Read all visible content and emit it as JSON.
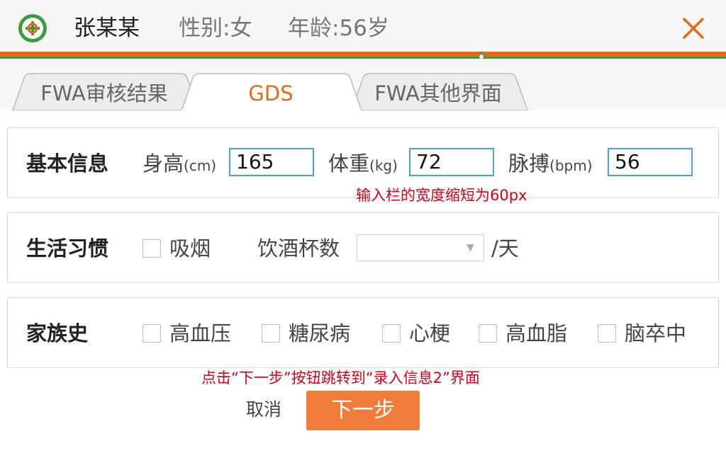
{
  "header": {
    "name": "张某某",
    "gender": "性别:女",
    "age": "年龄:56岁",
    "logo_icon": "app-logo-icon",
    "close_icon": "close-icon",
    "accent_color": "#e8661a"
  },
  "tabs": [
    {
      "label": "FWA审核结果",
      "active": false
    },
    {
      "label": "GDS",
      "active": true
    },
    {
      "label": "FWA其他界面",
      "active": false
    }
  ],
  "basic_info": {
    "title": "基本信息",
    "height_label": "身高",
    "height_unit": "(cm)",
    "height_value": "165",
    "weight_label": "体重",
    "weight_unit": "(kg)",
    "weight_value": "72",
    "pulse_label": "脉搏",
    "pulse_unit": "(bpm)",
    "pulse_value": "56",
    "note": "输入栏的宽度缩短为60px"
  },
  "habits": {
    "title": "生活习惯",
    "smoking_label": "吸烟",
    "drinking_label": "饮酒杯数",
    "drinking_value": "",
    "per_day": "/天"
  },
  "family_history": {
    "title": "家族史",
    "items": [
      "高血压",
      "糖尿病",
      "心梗",
      "高血脂",
      "脑卒中"
    ]
  },
  "actions": {
    "note": "点击“下一步”按钮跳转到“录入信息2”界面",
    "cancel_label": "取消",
    "next_label": "下一步",
    "next_color": "#f07c3c"
  }
}
